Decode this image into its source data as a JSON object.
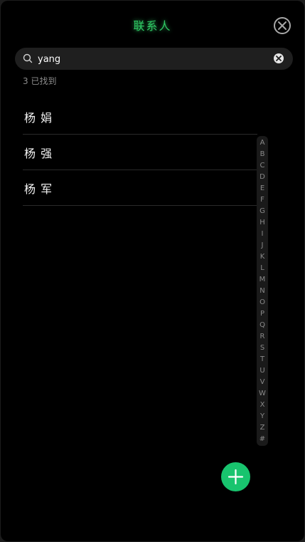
{
  "header": {
    "title": "联系人",
    "close_icon": "close-circle-icon"
  },
  "search": {
    "icon": "search-icon",
    "value": "yang",
    "clear_icon": "clear-icon"
  },
  "results": {
    "count_text": "3 已找到"
  },
  "contacts": [
    {
      "name": "杨 娟"
    },
    {
      "name": "杨 强"
    },
    {
      "name": "杨 军"
    }
  ],
  "alpha_index": [
    "A",
    "B",
    "C",
    "D",
    "E",
    "F",
    "G",
    "H",
    "I",
    "J",
    "K",
    "L",
    "M",
    "N",
    "O",
    "P",
    "Q",
    "R",
    "S",
    "T",
    "U",
    "V",
    "W",
    "X",
    "Y",
    "Z",
    "#"
  ],
  "fab": {
    "icon": "plus-icon"
  },
  "colors": {
    "accent": "#2fc864",
    "fab": "#18c46e",
    "background": "#000000",
    "muted_text": "#8c8c8c"
  }
}
